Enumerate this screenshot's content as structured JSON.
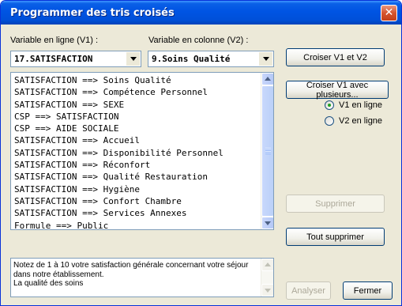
{
  "window": {
    "title": "Programmer des tris croisés",
    "close_glyph": "✕"
  },
  "variables": {
    "v1_label": "Variable en ligne (V1) :",
    "v1_value": "17.SATISFACTION",
    "v2_label": "Variable en colonne (V2) :",
    "v2_value": "9.Soins Qualité"
  },
  "buttons": {
    "cross": "Croiser V1 et V2",
    "cross_multi": "Croiser V1 avec plusieurs...",
    "delete": "Supprimer",
    "delete_all": "Tout supprimer",
    "analyze": "Analyser",
    "close": "Fermer"
  },
  "radios": {
    "v1_row": "V1 en ligne",
    "v2_row": "V2 en ligne",
    "selected": "v1_row"
  },
  "crosses": [
    "SATISFACTION ==> Soins Qualité",
    "SATISFACTION ==> Compétence Personnel",
    "SATISFACTION ==> SEXE",
    "CSP ==> SATISFACTION",
    "CSP ==> AIDE SOCIALE",
    "SATISFACTION ==> Accueil",
    "SATISFACTION ==> Disponibilité Personnel",
    "SATISFACTION ==> Réconfort",
    "SATISFACTION ==> Qualité Restauration",
    "SATISFACTION ==> Hygiène",
    "SATISFACTION ==> Confort Chambre",
    "SATISFACTION ==> Services Annexes",
    "Formule ==> Public"
  ],
  "description": {
    "line1": "Notez de 1 à 10 votre satisfaction générale concernant votre séjour",
    "line2": "dans notre établissement.",
    "line3": "La qualité des soins"
  },
  "icons": {
    "close": "close-icon",
    "dropdown": "chevron-down-icon",
    "scroll_up": "arrow-up-icon",
    "scroll_down": "arrow-down-icon"
  },
  "colors": {
    "title_bar": "#0054e3",
    "window_bg": "#ece9d8",
    "close_button": "#d6542e",
    "radio_dot": "#21a121"
  }
}
